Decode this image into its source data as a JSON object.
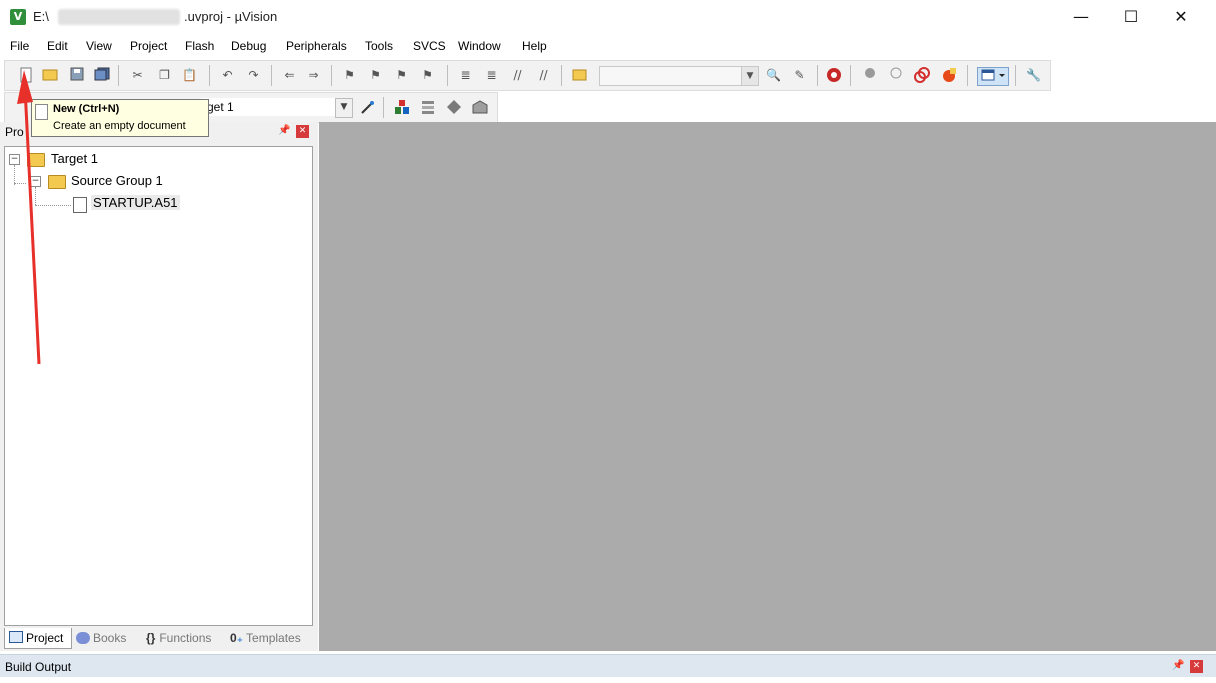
{
  "window": {
    "title_prefix": "E:\\",
    "title_suffix": ".uvproj - µVision",
    "minimize_glyph": "—",
    "maximize_glyph": "☐",
    "close_glyph": "✕"
  },
  "menu": [
    "File",
    "Edit",
    "View",
    "Project",
    "Flash",
    "Debug",
    "Peripherals",
    "Tools",
    "SVCS",
    "Window",
    "Help"
  ],
  "toolbar": {
    "target_name": "get 1"
  },
  "tooltip": {
    "title": "New (Ctrl+N)",
    "description": "Create an empty document"
  },
  "project_panel": {
    "title": "Pro",
    "tree": {
      "target": "Target 1",
      "group": "Source Group 1",
      "file": "STARTUP.A51"
    },
    "tabs": [
      "Project",
      "Books",
      "Functions",
      "Templates"
    ]
  },
  "build_output": {
    "title": "Build Output"
  },
  "colors": {
    "editor_background": "#ababab",
    "tooltip_background": "#ffffe1",
    "annotation_arrow": "#e8302a"
  }
}
